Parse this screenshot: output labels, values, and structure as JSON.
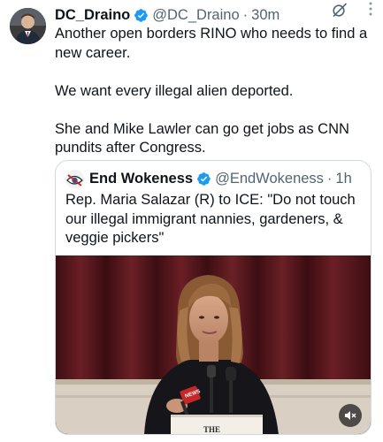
{
  "tweet": {
    "display_name": "DC_Draino",
    "handle": "@DC_Draino",
    "separator": "·",
    "time": "30m",
    "lines": [
      "Another open borders RINO who needs to find a new career.",
      "We want every illegal alien deported.",
      "She and Mike Lawler can go get jobs as CNN pundits after Congress."
    ]
  },
  "quoted_tweet": {
    "display_name": "End Wokeness",
    "handle": "@EndWokeness",
    "separator": "·",
    "time": "1h",
    "text": "Rep. Maria Salazar (R) to ICE: \"Do not touch our illegal immigrant nannies, gardeners, & veggie pickers\"",
    "media": {
      "podium_text": "THE",
      "mic_logo": "NEWS"
    }
  },
  "icons": {
    "verified": "verified-badge-icon",
    "grok": "grok-icon",
    "more": "more-options-icon",
    "mute": "muted-speaker-icon"
  },
  "colors": {
    "verified": "#1d9bf0",
    "secondary_text": "#536471",
    "border": "#cfd9de",
    "curtain": "#5a1a1f"
  }
}
